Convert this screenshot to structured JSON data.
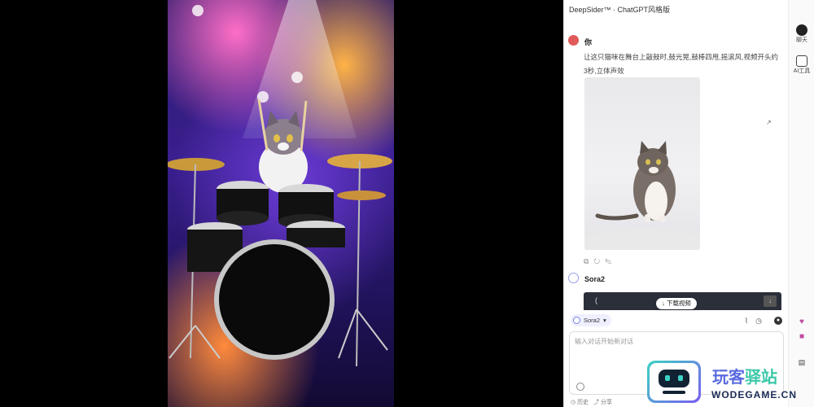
{
  "header": {
    "title": "DeepSider™ · ChatGPT风格版"
  },
  "messages": [
    {
      "sender": "你",
      "text": "让这只猫咪在舞台上敲鼓时,鼓光晃,鼓棒四甩,摇滚风,视频开头约3秒,立体声效",
      "attachment_icon": "cat-photo",
      "actions": [
        "copy-icon",
        "regenerate-icon",
        "edit-icon"
      ]
    },
    {
      "sender": "Sora2",
      "download_label": "↓ 下载视频",
      "card_left": "(",
      "card_right": "↓"
    }
  ],
  "model": {
    "name": "Sora2"
  },
  "composer": {
    "placeholder": "输入对话开始新对话"
  },
  "footer": {
    "history": "历史",
    "share": "分享"
  },
  "rail": [
    {
      "label": "聊天",
      "icon": "chat-icon"
    },
    {
      "label": "AI工具",
      "icon": "tools-icon"
    }
  ],
  "watermark": {
    "title_a": "玩客",
    "title_b": "驿站",
    "subtitle": "WODEGAME.CN"
  },
  "side_mark": "↗",
  "colors": {
    "accent": "#6b6fe0",
    "brand_teal": "#3cd3c4",
    "avatar_user": "#e15a5a"
  }
}
